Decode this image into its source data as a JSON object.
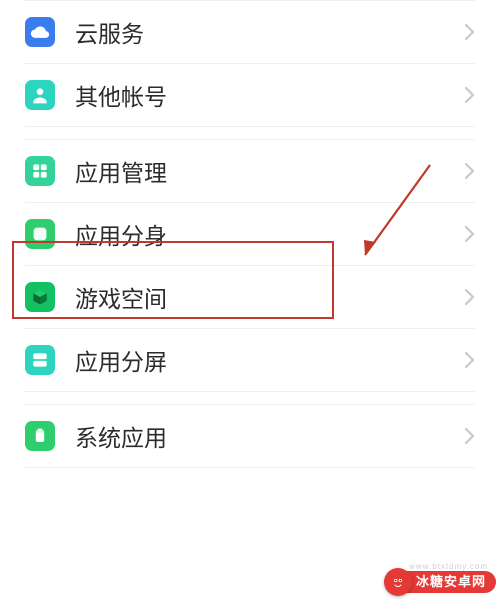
{
  "groups": {
    "g0": {
      "items": [
        {
          "key": "cloud",
          "label": "云服务",
          "icon": "cloud-icon",
          "icon_color": "#3b7cef"
        },
        {
          "key": "other_accounts",
          "label": "其他帐号",
          "icon": "person-icon",
          "icon_color": "#2dd4bf"
        }
      ]
    },
    "g1": {
      "items": [
        {
          "key": "app_management",
          "label": "应用管理",
          "icon": "apps-icon",
          "icon_color": "#34d399"
        },
        {
          "key": "app_clone",
          "label": "应用分身",
          "icon": "clone-icon",
          "icon_color": "#2dd777"
        },
        {
          "key": "game_space",
          "label": "游戏空间",
          "icon": "cube-icon",
          "icon_color": "#19b956"
        },
        {
          "key": "split_screen",
          "label": "应用分屏",
          "icon": "split-icon",
          "icon_color": "#2dd4bf"
        }
      ]
    },
    "g2": {
      "items": [
        {
          "key": "system_apps",
          "label": "系统应用",
          "icon": "android-icon",
          "icon_color": "#2ec977"
        }
      ]
    }
  },
  "highlight": {
    "target_key": "app_clone"
  },
  "watermark": {
    "text": "冰糖安卓网",
    "url": "www.btxtdmy.com"
  }
}
